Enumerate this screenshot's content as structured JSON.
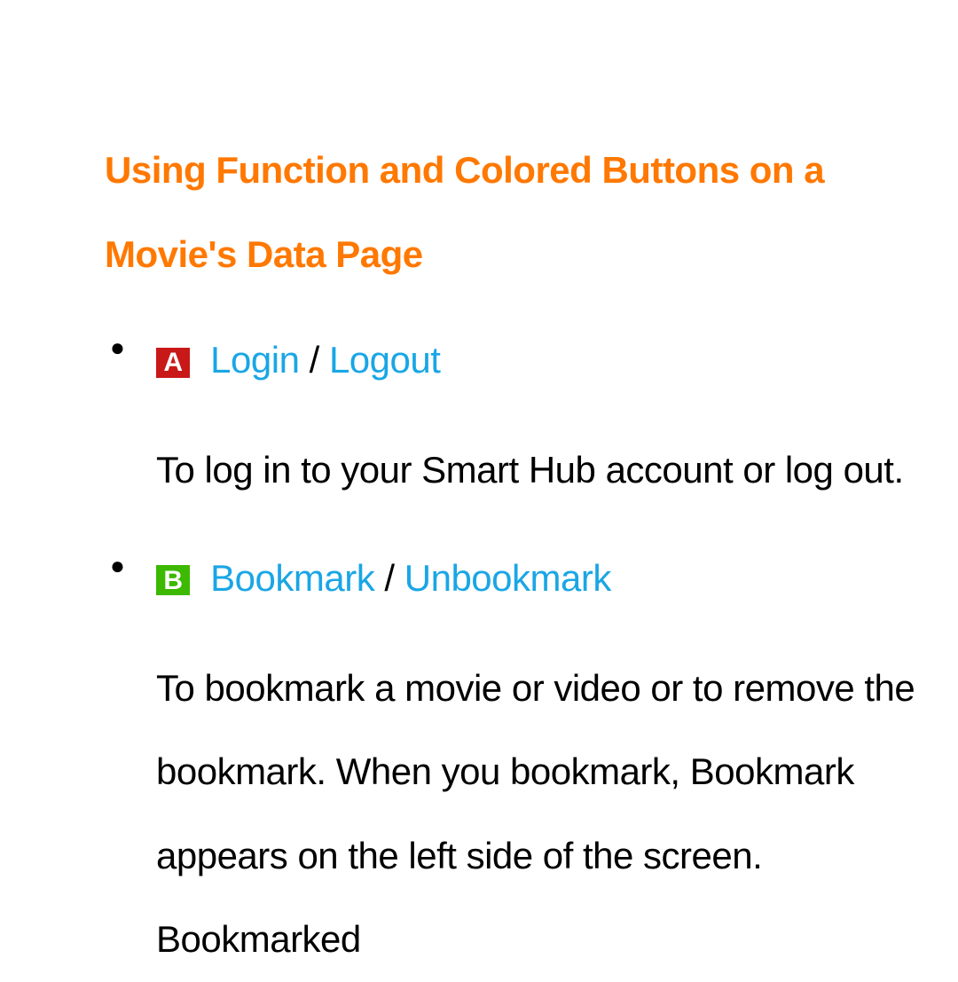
{
  "heading": "Using Function and Colored Buttons on a Movie's Data Page",
  "items": [
    {
      "badge_letter": "A",
      "badge_class": "badge-a",
      "action1": "Login",
      "separator": " / ",
      "action2": "Logout",
      "description": "To log in to your Smart Hub account or log out."
    },
    {
      "badge_letter": "B",
      "badge_class": "badge-b",
      "action1": "Bookmark",
      "separator": " / ",
      "action2": "Unbookmark",
      "description": "To bookmark a movie or video or to remove the bookmark. When you bookmark, Bookmark appears on the left side of the screen. Bookmarked"
    }
  ]
}
